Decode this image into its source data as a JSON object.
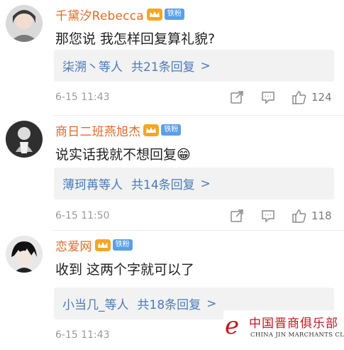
{
  "comments": [
    {
      "username": "千黛汐Rebecca",
      "fan_badge": "铁粉",
      "text": "那您说 我怎样回复算礼貌?",
      "replies": {
        "users": "柒溯丶等人",
        "count_text": "共21条回复",
        "chevron": ">"
      },
      "time": "6-15 11:43",
      "likes": "124"
    },
    {
      "username": "商日二班燕旭杰",
      "fan_badge": "铁粉",
      "text": "说实话我就不想回复😁",
      "replies": {
        "users": "薄珂苒等人",
        "count_text": "共14条回复",
        "chevron": ">"
      },
      "time": "6-15 11:50",
      "likes": "118"
    },
    {
      "username": "恋爱网",
      "fan_badge": "铁粉",
      "text": "收到  这两个字就可以了",
      "replies": {
        "users": "小当几_等人",
        "count_text": "共18条回复",
        "chevron": ">"
      },
      "time": "6-15 11:43",
      "likes": ""
    }
  ],
  "icons": {
    "vip": "vip-crown-icon",
    "share": "share-icon",
    "comment": "comment-icon",
    "like": "thumbs-up-icon"
  },
  "watermark": {
    "logo_letter": "e",
    "cn_text": "中国晋商俱乐部",
    "en_text": "CHINA JIN MARCHANTS CLUB"
  },
  "colors": {
    "username": "#e06b2a",
    "reply_link": "#4a7bb8",
    "reply_box_bg": "#f2f2f2",
    "fan_badge_bg": "#5aa0e8",
    "watermark_red": "#c0161d"
  }
}
